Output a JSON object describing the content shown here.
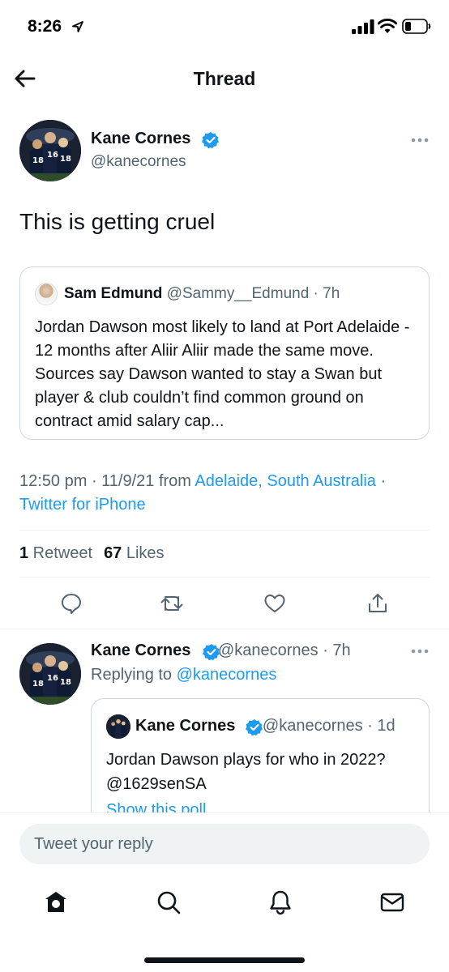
{
  "status_bar": {
    "time": "8:26"
  },
  "header": {
    "title": "Thread"
  },
  "main_tweet": {
    "author_name": "Kane Cornes",
    "author_handle": "@kanecornes",
    "text": "This is getting cruel",
    "quote": {
      "name": "Sam Edmund",
      "meta": " @Sammy__Edmund · 7h",
      "body": "Jordan Dawson most likely to land at Port Adelaide - 12 months after Aliir Aliir made the same move. Sources say Dawson wanted to stay a Swan but player & club couldn’t find common ground on contract amid salary cap..."
    },
    "timestamp": "12:50 pm · 11/9/21 from ",
    "location": "Adelaide, South Australia",
    "separator": " ·",
    "source": "Twitter for iPhone",
    "retweet_count": "1",
    "retweet_label": " Retweet",
    "like_count": "67",
    "like_label": " Likes"
  },
  "reply_tweet": {
    "author_name": "Kane Cornes",
    "meta": " @kanecornes · 7h",
    "replying_prefix": "Replying to ",
    "replying_handle": "@kanecornes",
    "quote": {
      "name": "Kane Cornes",
      "meta": " @kanecornes · 1d",
      "body": "Jordan Dawson plays for who in 2022?  @1629senSA",
      "link": "Show this poll"
    }
  },
  "compose": {
    "placeholder": "Tweet your reply"
  },
  "icons": {
    "back": "arrow-left-icon",
    "verified": "verified-badge-icon",
    "more": "more-dots-icon",
    "reply": "reply-bubble-icon",
    "retweet": "retweet-icon",
    "like": "heart-icon",
    "share": "share-icon",
    "home": "home-icon",
    "search": "search-icon",
    "notifications": "bell-icon",
    "messages": "envelope-icon"
  },
  "colors": {
    "accent": "#1d9bf0",
    "text": "#0f1419",
    "secondary": "#536471",
    "border": "#cfd9de"
  }
}
